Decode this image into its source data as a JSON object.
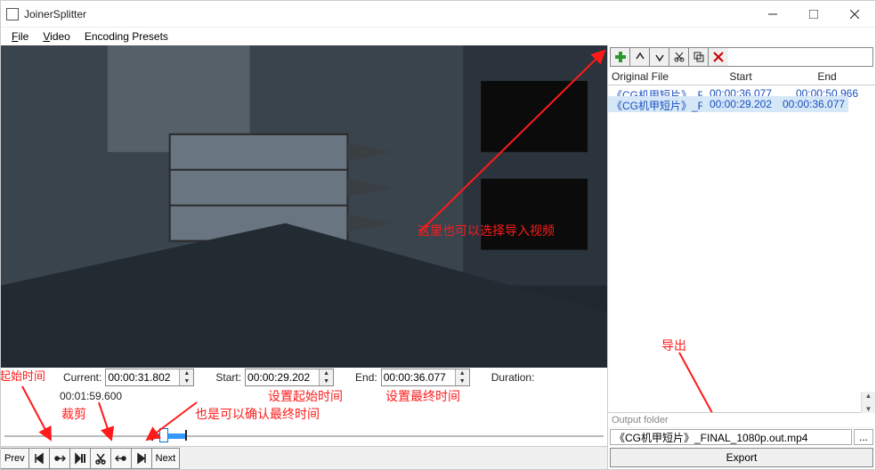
{
  "window": {
    "title": "JoinerSplitter"
  },
  "menu": {
    "file": "File",
    "video": "Video",
    "encoding": "Encoding Presets"
  },
  "time": {
    "current_label": "Current:",
    "current_value": "00:00:31.802",
    "total_value": "00:01:59.600",
    "start_label": "Start:",
    "start_value": "00:00:29.202",
    "end_label": "End:",
    "end_value": "00:00:36.077",
    "duration_label": "Duration:"
  },
  "annotations": {
    "import_here": "这里也可以选择导入视频",
    "start_time": "起始时间",
    "cut": "裁剪",
    "set_start": "设置起始时间",
    "set_end": "设置最终时间",
    "also_confirm_end": "也是可以确认最终时间",
    "export": "导出"
  },
  "slider": {
    "total": 119.6,
    "start": 29.202,
    "end": 36.077,
    "current": 31.802
  },
  "toolbar": {
    "prev": "Prev",
    "next": "Next"
  },
  "clip_toolbar": {
    "add": "add",
    "up": "up",
    "down": "down",
    "cut": "cut",
    "copy": "copy",
    "delete": "delete"
  },
  "clips": {
    "headers": {
      "file": "Original File",
      "start": "Start",
      "end": "End"
    },
    "rows": [
      {
        "file": "《CG机甲短片》_F",
        "start": "00:00:29.202",
        "end": "00:00:36.077",
        "selected": true
      },
      {
        "file": "《CG机甲短片》_F",
        "start": "00:00:36.077",
        "end": "00:00:50.966",
        "selected": false
      }
    ]
  },
  "output": {
    "folder_label": "Output folder",
    "path": "《CG机甲短片》_FINAL_1080p.out.mp4",
    "export_label": "Export"
  }
}
